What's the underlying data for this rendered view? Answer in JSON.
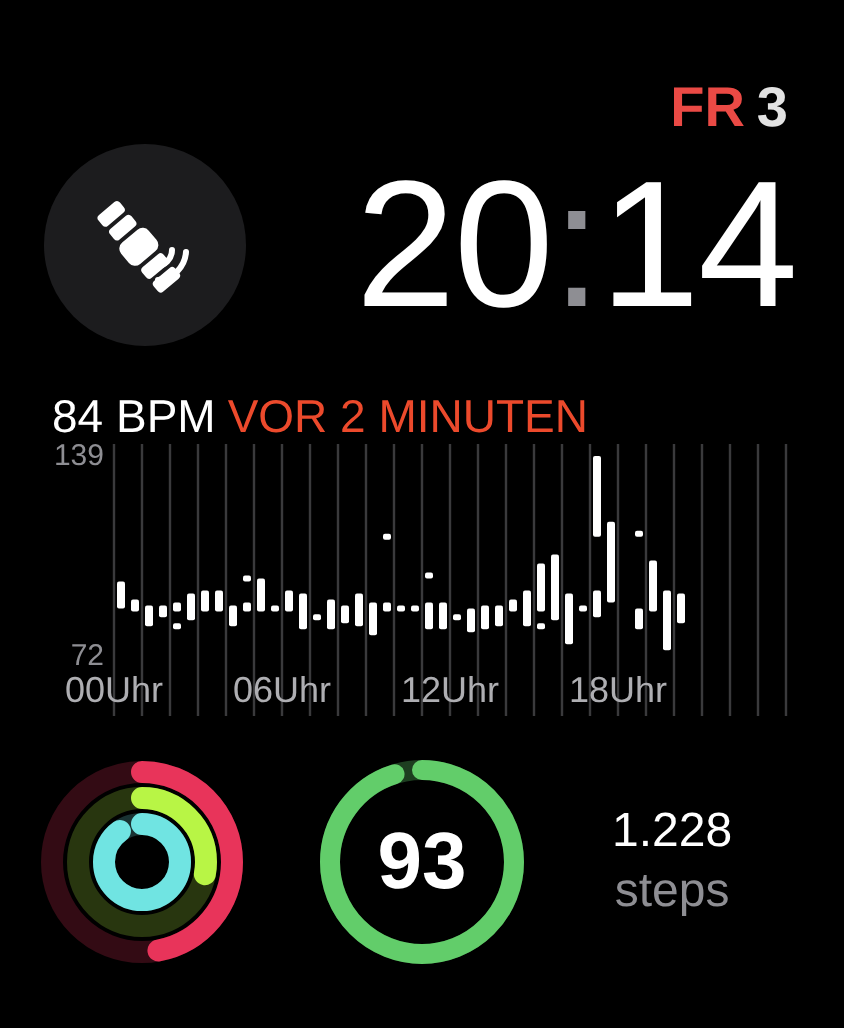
{
  "date": {
    "weekday": "FR",
    "day": "3"
  },
  "time": {
    "hours": "20",
    "separator": ":",
    "minutes": "14"
  },
  "heart_rate": {
    "reading": "84 BPM",
    "time_ago": "VOR 2 MINUTEN",
    "chart_data": {
      "type": "candlestick",
      "ylim": [
        52,
        143
      ],
      "xlim": [
        0,
        24
      ],
      "yticks": [
        72,
        139
      ],
      "grid": true,
      "xticks": [
        {
          "value": 0,
          "label": "00Uhr"
        },
        {
          "value": 6,
          "label": "06Uhr"
        },
        {
          "value": 12,
          "label": "12Uhr"
        },
        {
          "value": 18,
          "label": "18Uhr"
        }
      ],
      "x": [
        0.25,
        0.75,
        1.25,
        1.75,
        2.25,
        2.75,
        3.25,
        3.75,
        4.25,
        4.75,
        5.25,
        5.75,
        6.25,
        6.75,
        7.25,
        7.75,
        8.25,
        8.75,
        9.25,
        9.75,
        10.25,
        10.75,
        11.25,
        11.75,
        12.25,
        12.75,
        13.25,
        13.75,
        14.25,
        14.75,
        15.25,
        15.75,
        16.25,
        16.75,
        17.25,
        17.75,
        18.75,
        19.25,
        19.75,
        20.25
      ],
      "series": [
        {
          "color": "#ffffff",
          "ohlc": [
            [
              88,
              97,
              88,
              97
            ],
            [
              87,
              91,
              87,
              91
            ],
            [
              82,
              89,
              82,
              89
            ],
            [
              85,
              89,
              85,
              89
            ],
            [
              87,
              90,
              87,
              90
            ],
            [
              84,
              93,
              84,
              93
            ],
            [
              87,
              94,
              87,
              94
            ],
            [
              87,
              94,
              87,
              94
            ],
            [
              82,
              89,
              82,
              89
            ],
            [
              87,
              90,
              87,
              90
            ],
            [
              87,
              98,
              87,
              98
            ],
            [
              87,
              89,
              87,
              89
            ],
            [
              87,
              94,
              87,
              94
            ],
            [
              81,
              93,
              81,
              93
            ],
            [
              84,
              86,
              84,
              86
            ],
            [
              81,
              91,
              81,
              91
            ],
            [
              83,
              89,
              83,
              89
            ],
            [
              82,
              93,
              82,
              93
            ],
            [
              79,
              90,
              79,
              90
            ],
            [
              87,
              90,
              87,
              90
            ],
            [
              87,
              89,
              87,
              89
            ],
            [
              87,
              89,
              87,
              89
            ],
            [
              81,
              90,
              81,
              90
            ],
            [
              81,
              90,
              81,
              90
            ],
            [
              84,
              86,
              84,
              86
            ],
            [
              80,
              88,
              80,
              88
            ],
            [
              81,
              89,
              81,
              89
            ],
            [
              82,
              89,
              82,
              89
            ],
            [
              87,
              91,
              87,
              91
            ],
            [
              82,
              94,
              82,
              94
            ],
            [
              87,
              103,
              87,
              103
            ],
            [
              84,
              106,
              84,
              106
            ],
            [
              76,
              93,
              76,
              93
            ],
            [
              87,
              89,
              87,
              89
            ],
            [
              112,
              139,
              112,
              139
            ],
            [
              90,
              117,
              90,
              117
            ],
            [
              81,
              88,
              81,
              88
            ],
            [
              87,
              104,
              87,
              104
            ],
            [
              74,
              94,
              74,
              94
            ],
            [
              83,
              93,
              83,
              93
            ]
          ]
        },
        {
          "color": "#ffffff",
          "ohlc": [
            null,
            null,
            null,
            null,
            [
              81,
              83,
              81,
              83
            ],
            null,
            null,
            null,
            null,
            [
              97,
              99,
              97,
              99
            ],
            null,
            null,
            null,
            null,
            null,
            null,
            null,
            null,
            null,
            [
              111,
              113,
              111,
              113
            ],
            null,
            null,
            [
              98,
              100,
              98,
              100
            ],
            null,
            null,
            null,
            null,
            null,
            null,
            null,
            [
              81,
              83,
              81,
              83
            ],
            null,
            null,
            null,
            [
              85,
              94,
              85,
              94
            ],
            null,
            [
              112,
              114,
              112,
              114
            ],
            null,
            null,
            null
          ]
        }
      ]
    }
  },
  "activity": {
    "rings": [
      {
        "color": "#e8345a"
      },
      {
        "color": "#b8f545"
      },
      {
        "color": "#70e4e2"
      }
    ]
  },
  "score": {
    "value": "93",
    "color": "#62cd6a"
  },
  "steps": {
    "count": "1.228",
    "unit": "steps"
  }
}
